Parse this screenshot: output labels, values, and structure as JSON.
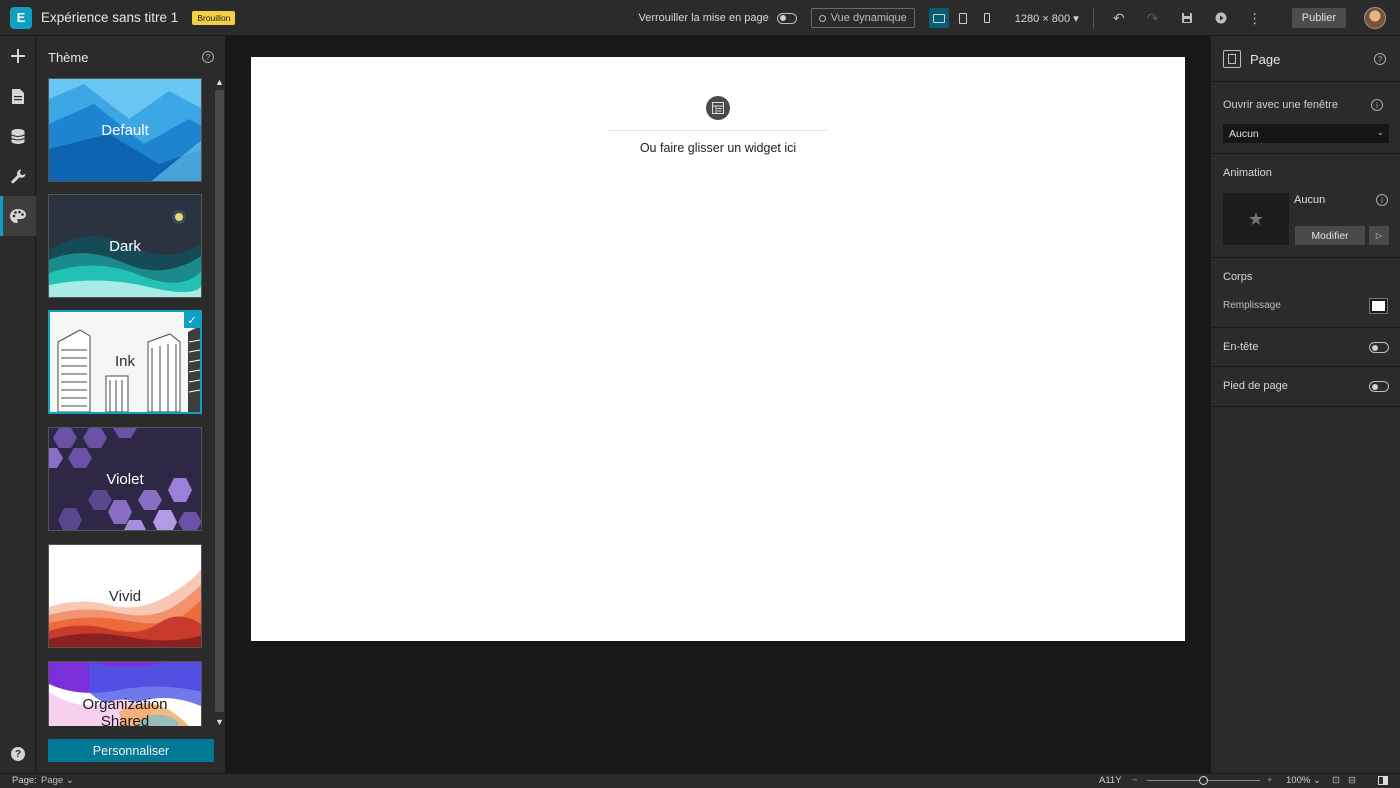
{
  "header": {
    "logo_glyph": "E",
    "title": "Expérience sans titre 1",
    "badge": "Brouillon",
    "lock_layout_label": "Verrouiller la mise en page",
    "dynamic_view_label": "Vue dynamique",
    "resolution": "1280 × 800",
    "publish_label": "Publier",
    "accent_color": "#11a0c0"
  },
  "rail": {
    "items": [
      {
        "name": "add-icon"
      },
      {
        "name": "page-icon"
      },
      {
        "name": "data-icon"
      },
      {
        "name": "wrench-icon"
      },
      {
        "name": "palette-icon",
        "active": true
      }
    ],
    "help_glyph": "?"
  },
  "theme_panel": {
    "title": "Thème",
    "help_glyph": "?",
    "themes": [
      {
        "name": "Default"
      },
      {
        "name": "Dark"
      },
      {
        "name": "Ink",
        "selected": true
      },
      {
        "name": "Violet"
      },
      {
        "name": "Vivid"
      },
      {
        "name": "Organization Shared"
      }
    ],
    "customize_label": "Personnaliser"
  },
  "canvas": {
    "drop_text": "Ou faire glisser un widget ici"
  },
  "right_panel": {
    "title": "Page",
    "help_glyph": "?",
    "open_with_window_label": "Ouvrir avec une fenêtre",
    "open_with_window_value": "Aucun",
    "animation_label": "Animation",
    "animation_value": "Aucun",
    "modify_label": "Modifier",
    "body_label": "Corps",
    "fill_label": "Remplissage",
    "fill_color": "#ffffff",
    "header_label": "En-tête",
    "footer_label": "Pied de page",
    "info_glyph": "i"
  },
  "footer": {
    "page_label": "Page:",
    "page_value": "Page",
    "a11y": "A11Y",
    "zoom": "100%",
    "zoom_level": 0.5
  }
}
